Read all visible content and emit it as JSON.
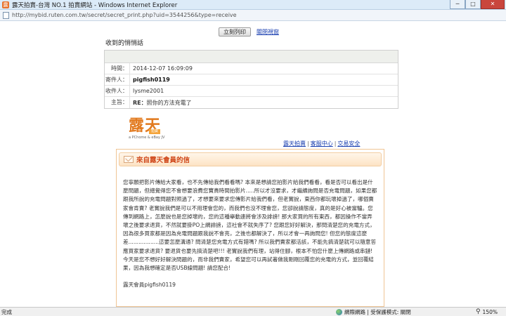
{
  "window": {
    "title": "露天拍賣-台灣 NO.1 拍賣網站 - Windows Internet Explorer",
    "app_icon": "露",
    "controls": {
      "minimize": "─",
      "maximize": "□",
      "close": "✕"
    }
  },
  "address": {
    "url": "http://mybid.ruten.com.tw/secret/secret_print.php?uid=3544256&type=receive"
  },
  "toolbar": {
    "print_label": "立刻列印",
    "close_label": "關閉視窗"
  },
  "message": {
    "heading": "收到的悄悄話",
    "rows": [
      {
        "label": "時間：",
        "value": "2014-12-07 16:09:09"
      },
      {
        "label": "寄件人：",
        "value": "pigfish0119"
      },
      {
        "label": "收件人：",
        "value": "lysme2001"
      }
    ],
    "subject_label": "主旨：",
    "subject_prefix": "RE：",
    "subject_text": "照你的方法充電了"
  },
  "email": {
    "logo_text": "露天",
    "logo_tag": "拍賣",
    "logo_sub": "a PChome & eBay JV",
    "nav": [
      "露天拍賣",
      "客服中心",
      "交易安全"
    ],
    "nav_sep": "|",
    "title": "來自露天會員的信",
    "body": "您寧願把影片傳給大家看，也不先傳給我們看看嗎? 本來是想請您拍影片給我們看看，看是否可以看出是什麼問題，但總覺得您不會想要浪費您寶貴時間拍影片.....所以才沒要求，才繼續詢問是否充電問題，如果您都跟我所說的充電問題對照過了，才想要來要求您傳影片給我們看，但老實說，東西你都玩壞掉過了，哪個賣家會肯賣? 老實說我們是可以不用理會您的，而我們也沒不理會您，您卻說請態度，真的是好心被當驢。您傳到網路上，怎麼說也是您掉壞的，您的這種舉動連將會涉及誹謗! 那大家買的所有東西，都因操作不當弄壞之後要求退貨，不然就要掛PO上網誹謗，這社會不就失序了? 您跟您好好解決，那問清楚您的充電方式，因為很多買家都是因為充電問題跟我說不會亮，之後也都解決了，所以才會一再詢問您! 但您的態度這麼差..................這要怎麼溝通? 問清楚您充電方式有錯嗎? 所以我們賣家都活該，不能先搞清楚就可以隨意答應買家要求退貨? 要退貨也要先搞清楚吧!!! 老實說我們有理，站得住腳，根本不怕您什麼上傳網路或串鏈! 今天是您不想好好解決問題的，而非我們賣家，希望您可以再試著做我剛剛回覆您的充電的方式，並回覆結果，因為我想確定是否USB線問題! 請您配合!",
    "signature": "露天會員pigfish0119"
  },
  "status": {
    "left": "完成",
    "zone": "網際網路 | 受保護模式: 關閉",
    "zoom": "150%"
  }
}
